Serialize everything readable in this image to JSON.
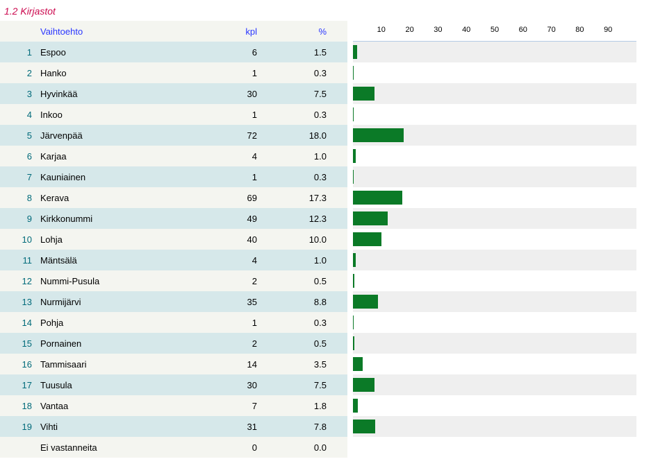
{
  "title": "1.2 Kirjastot",
  "headers": {
    "name": "Vaihtoehto",
    "kpl": "kpl",
    "pct": "%"
  },
  "rows": [
    {
      "num": "1",
      "name": "Espoo",
      "kpl": "6",
      "pct": "1.5"
    },
    {
      "num": "2",
      "name": "Hanko",
      "kpl": "1",
      "pct": "0.3"
    },
    {
      "num": "3",
      "name": "Hyvinkää",
      "kpl": "30",
      "pct": "7.5"
    },
    {
      "num": "4",
      "name": "Inkoo",
      "kpl": "1",
      "pct": "0.3"
    },
    {
      "num": "5",
      "name": "Järvenpää",
      "kpl": "72",
      "pct": "18.0"
    },
    {
      "num": "6",
      "name": "Karjaa",
      "kpl": "4",
      "pct": "1.0"
    },
    {
      "num": "7",
      "name": "Kauniainen",
      "kpl": "1",
      "pct": "0.3"
    },
    {
      "num": "8",
      "name": "Kerava",
      "kpl": "69",
      "pct": "17.3"
    },
    {
      "num": "9",
      "name": "Kirkkonummi",
      "kpl": "49",
      "pct": "12.3"
    },
    {
      "num": "10",
      "name": "Lohja",
      "kpl": "40",
      "pct": "10.0"
    },
    {
      "num": "11",
      "name": "Mäntsälä",
      "kpl": "4",
      "pct": "1.0"
    },
    {
      "num": "12",
      "name": "Nummi-Pusula",
      "kpl": "2",
      "pct": "0.5"
    },
    {
      "num": "13",
      "name": "Nurmijärvi",
      "kpl": "35",
      "pct": "8.8"
    },
    {
      "num": "14",
      "name": "Pohja",
      "kpl": "1",
      "pct": "0.3"
    },
    {
      "num": "15",
      "name": "Pornainen",
      "kpl": "2",
      "pct": "0.5"
    },
    {
      "num": "16",
      "name": "Tammisaari",
      "kpl": "14",
      "pct": "3.5"
    },
    {
      "num": "17",
      "name": "Tuusula",
      "kpl": "30",
      "pct": "7.5"
    },
    {
      "num": "18",
      "name": "Vantaa",
      "kpl": "7",
      "pct": "1.8"
    },
    {
      "num": "19",
      "name": "Vihti",
      "kpl": "31",
      "pct": "7.8"
    },
    {
      "num": "",
      "name": "Ei vastanneita",
      "kpl": "0",
      "pct": "0.0"
    }
  ],
  "axis_ticks": [
    "10",
    "20",
    "30",
    "40",
    "50",
    "60",
    "70",
    "80",
    "90"
  ],
  "chart_data": {
    "type": "bar",
    "orientation": "horizontal",
    "title": "1.2 Kirjastot",
    "xlabel": "%",
    "xlim": [
      0,
      100
    ],
    "categories": [
      "Espoo",
      "Hanko",
      "Hyvinkää",
      "Inkoo",
      "Järvenpää",
      "Karjaa",
      "Kauniainen",
      "Kerava",
      "Kirkkonummi",
      "Lohja",
      "Mäntsälä",
      "Nummi-Pusula",
      "Nurmijärvi",
      "Pohja",
      "Pornainen",
      "Tammisaari",
      "Tuusula",
      "Vantaa",
      "Vihti",
      "Ei vastanneita"
    ],
    "values": [
      1.5,
      0.3,
      7.5,
      0.3,
      18.0,
      1.0,
      0.3,
      17.3,
      12.3,
      10.0,
      1.0,
      0.5,
      8.8,
      0.3,
      0.5,
      3.5,
      7.5,
      1.8,
      7.8,
      0.0
    ],
    "series": [
      {
        "name": "kpl",
        "values": [
          6,
          1,
          30,
          1,
          72,
          4,
          1,
          69,
          49,
          40,
          4,
          2,
          35,
          1,
          2,
          14,
          30,
          7,
          31,
          0
        ]
      },
      {
        "name": "%",
        "values": [
          1.5,
          0.3,
          7.5,
          0.3,
          18.0,
          1.0,
          0.3,
          17.3,
          12.3,
          10.0,
          1.0,
          0.5,
          8.8,
          0.3,
          0.5,
          3.5,
          7.5,
          1.8,
          7.8,
          0.0
        ]
      }
    ]
  }
}
